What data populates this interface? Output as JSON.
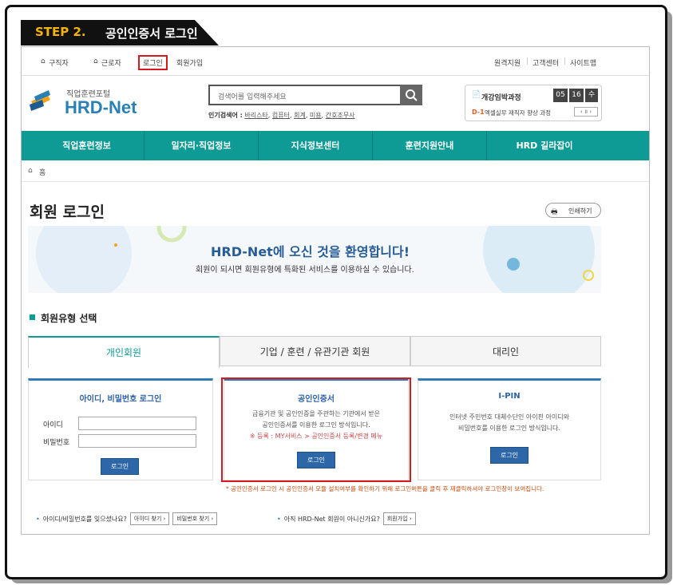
{
  "step": {
    "num": "STEP 2.",
    "title": "공인인증서 로그인"
  },
  "topnav": {
    "left": [
      "구직자",
      "근로자",
      "로그인",
      "회원가입"
    ],
    "right": [
      "원격지원",
      "고객센터",
      "사이트맵"
    ]
  },
  "logo": {
    "tagline": "직업훈련포털",
    "name": "HRD-Net"
  },
  "search": {
    "placeholder": "검색어를 입력해주세요",
    "popular_label": "인기검색어 :",
    "popular": [
      "바리스타",
      "컴퓨터",
      "회계",
      "미용",
      "간호조무사"
    ]
  },
  "opening": {
    "title": "개강임박과정",
    "days": [
      "05",
      "16",
      "수"
    ],
    "d": "D-1",
    "course": "엑셀실무 재직자 향상 과정"
  },
  "nav": [
    "직업훈련정보",
    "일자리·직업정보",
    "지식정보센터",
    "훈련지원안내",
    "HRD 길라잡이"
  ],
  "breadcrumb": "홈",
  "page_title": "회원 로그인",
  "print_label": "인쇄하기",
  "welcome": {
    "title": "HRD-Net에 오신 것을 환영합니다!",
    "sub": "회원이 되시면 회원유형에 특화된 서비스를 이용하실 수 있습니다."
  },
  "section_title": "회원유형 선택",
  "tabs": [
    "개인회원",
    "기업 / 훈련 / 유관기관 회원",
    "대리인"
  ],
  "card_id": {
    "title": "아이디, 비밀번호 로그인",
    "id_label": "아이디",
    "pw_label": "비밀번호",
    "btn": "로그인"
  },
  "card_cert": {
    "title": "공인인증서",
    "line1": "금융기관 및 공인인증을 주관하는 기관에서 받은",
    "line2": "공인인증서를 이용한 로그인 방식입니다.",
    "line3": "※ 등록 : MY서비스 > 공인인증서 등록/변경 메뉴",
    "btn": "로그인"
  },
  "card_ipin": {
    "title": "I-PIN",
    "line1": "인터넷 주민번호 대체수단인 아이핀 아이디와",
    "line2": "비밀번호를 이용한 로그인 방식입니다.",
    "btn": "로그인"
  },
  "note": "* 공인인증서 로그인 시 공인인증서 모듈 설치여부를 확인하기 위해 로그인버튼을 클릭 후 재클릭하셔야 로그인창이 보여집니다.",
  "bottom": {
    "forgot": "아이디/비밀번호를 잊으셨나요?",
    "find_id": "아이디 찾기",
    "find_pw": "비밀번호 찾기",
    "not_member": "아직 HRD-Net 회원이 아니신가요?",
    "join": "회원가입"
  }
}
